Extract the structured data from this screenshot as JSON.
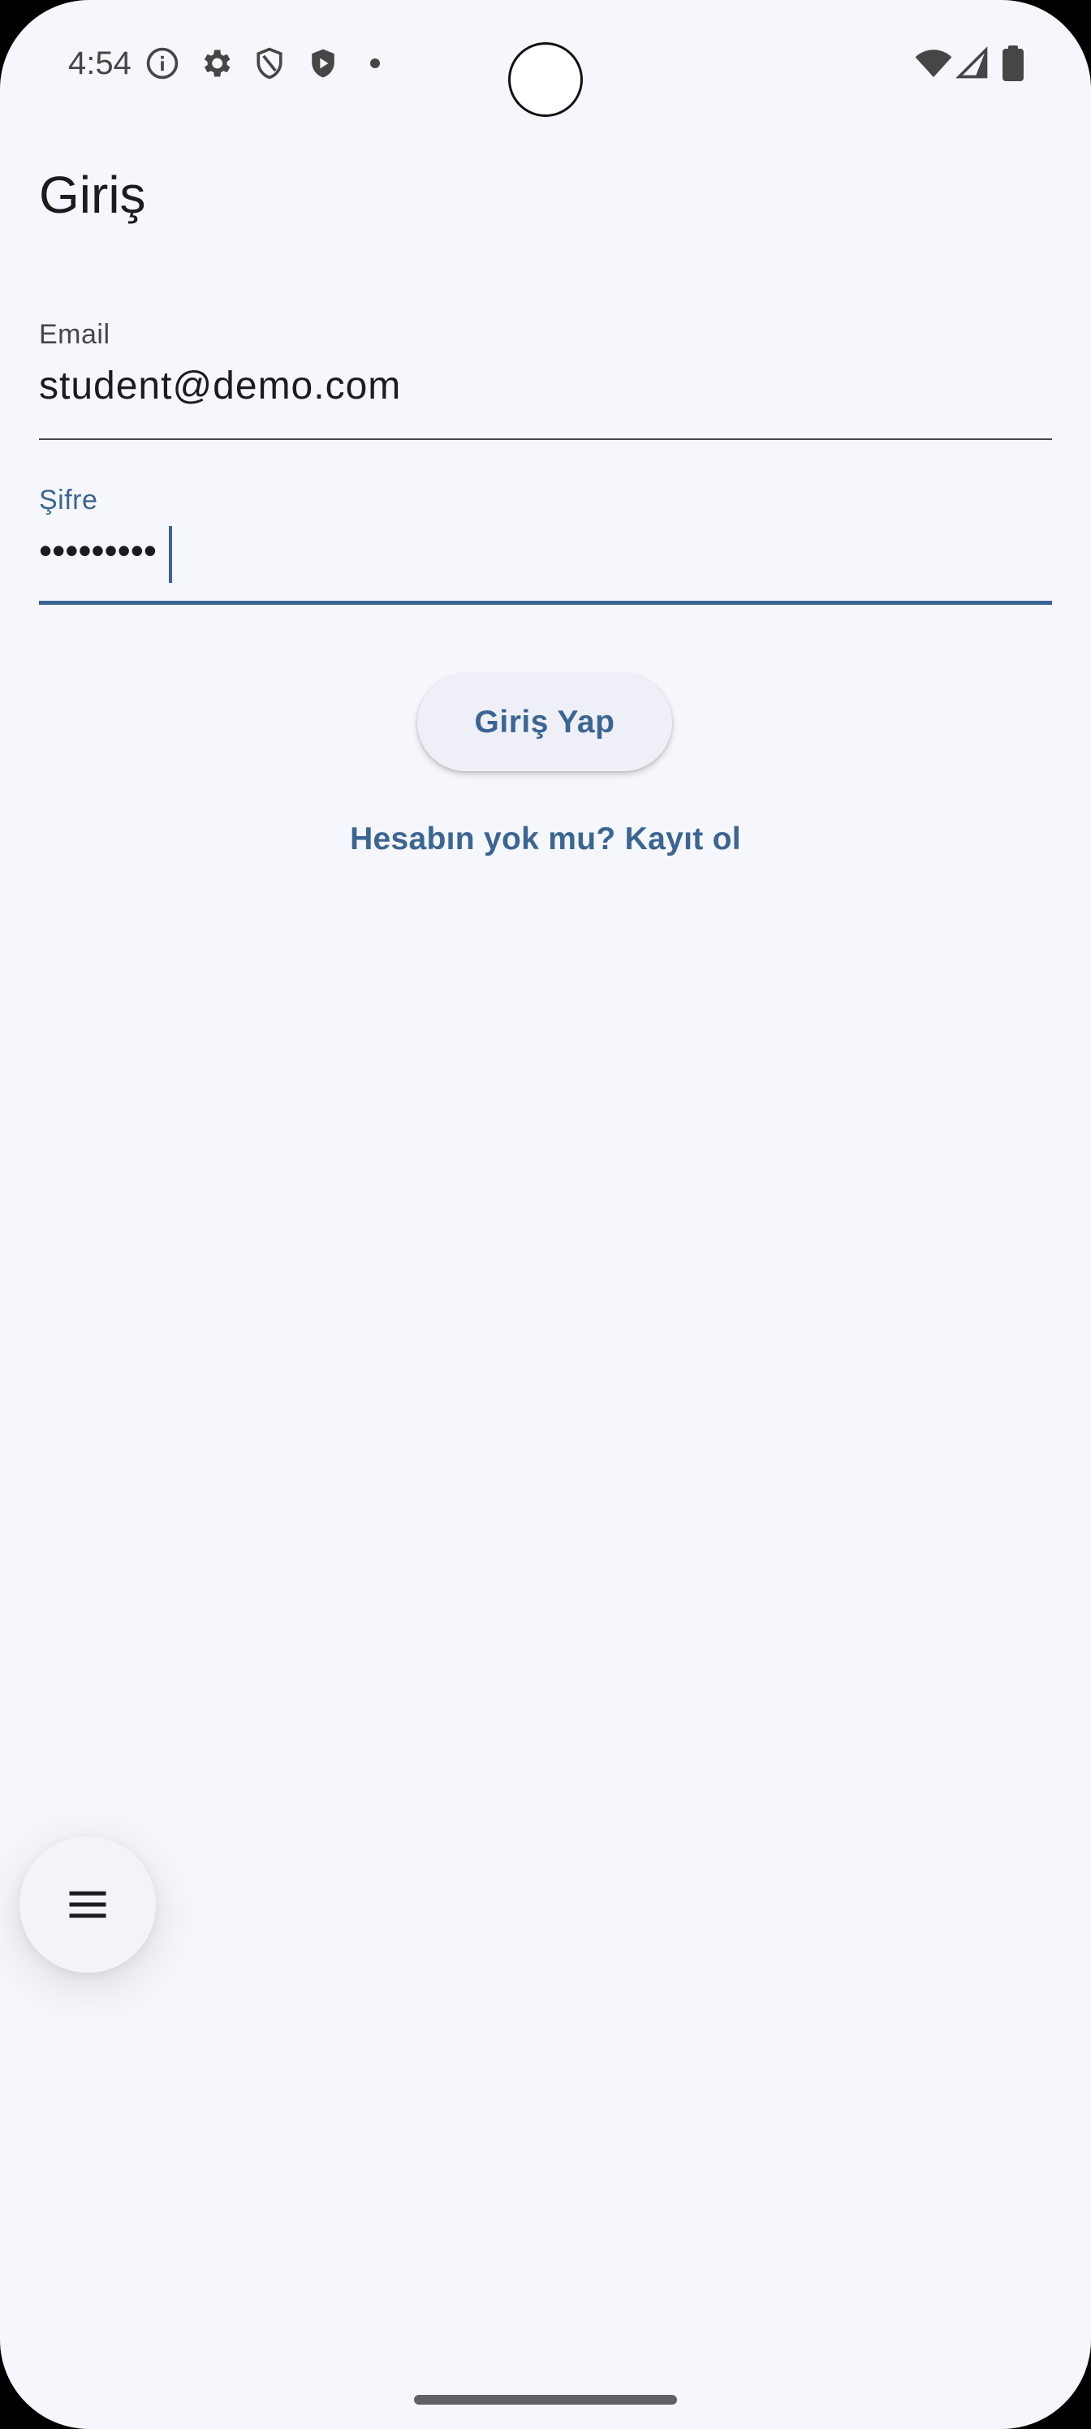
{
  "status_bar": {
    "time": "4:54",
    "left_icons": [
      "info-icon",
      "gear-icon",
      "shield-icon",
      "play-shield-icon"
    ],
    "right_icons": [
      "wifi-icon",
      "signal-icon",
      "battery-icon"
    ]
  },
  "app_bar": {
    "title": "Giriş"
  },
  "form": {
    "email": {
      "label": "Email",
      "value": "student@demo.com"
    },
    "password": {
      "label": "Şifre",
      "value": "•••••••••"
    },
    "login_label": "Giriş Yap",
    "register_link": "Hesabın yok mu? Kayıt ol"
  },
  "fab": {
    "icon": "menu-icon"
  },
  "colors": {
    "background": "#f6f7fc",
    "accent": "#3b6593",
    "text": "#1a1c1e",
    "label": "#44474e"
  }
}
